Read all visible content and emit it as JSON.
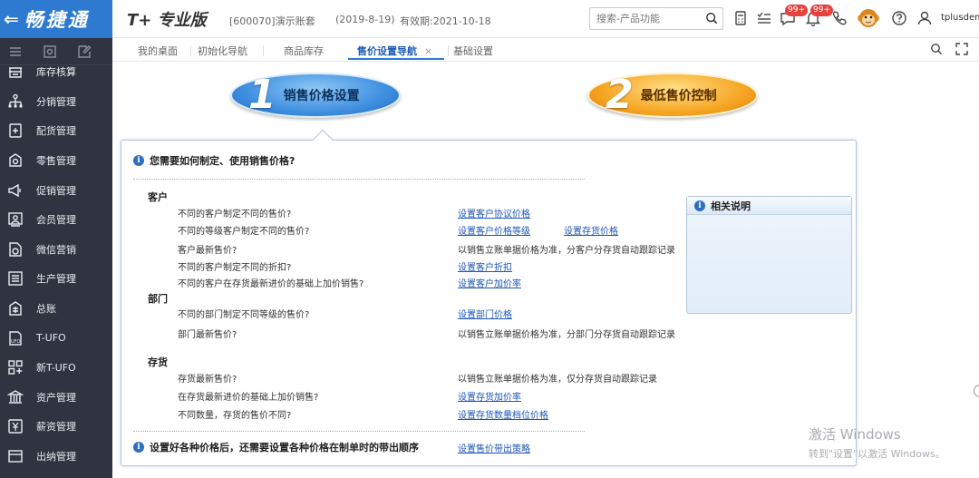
{
  "brand": {
    "back_glyph": "⇐",
    "name": "畅捷通"
  },
  "header": {
    "product": "T+ 专业版",
    "account": "[600070]演示账套",
    "period": "(2019-8-19)",
    "validity": "有效期:2021-10-18",
    "search_placeholder": "搜索-产品功能",
    "badge_messages": "99+",
    "badge_notices": "99+",
    "user": "tplusdem"
  },
  "tabs": [
    {
      "label": "我的桌面"
    },
    {
      "label": "初始化导航"
    },
    {
      "label": "商品库存"
    },
    {
      "label": "售价设置导航",
      "active": true,
      "close": "×"
    },
    {
      "label": "基础设置"
    }
  ],
  "sidebar": {
    "items": [
      {
        "label": "库存核算",
        "icon": "inventory-icon"
      },
      {
        "label": "分销管理",
        "icon": "distribution-icon"
      },
      {
        "label": "配货管理",
        "icon": "allocation-icon"
      },
      {
        "label": "零售管理",
        "icon": "retail-icon"
      },
      {
        "label": "促销管理",
        "icon": "promotion-icon"
      },
      {
        "label": "会员管理",
        "icon": "member-icon"
      },
      {
        "label": "微信营销",
        "icon": "wechat-icon"
      },
      {
        "label": "生产管理",
        "icon": "production-icon"
      },
      {
        "label": "总账",
        "icon": "ledger-icon"
      },
      {
        "label": "T-UFO",
        "icon": "ufo-icon"
      },
      {
        "label": "新T-UFO",
        "icon": "new-ufo-icon"
      },
      {
        "label": "资产管理",
        "icon": "asset-icon"
      },
      {
        "label": "薪资管理",
        "icon": "salary-icon"
      },
      {
        "label": "出纳管理",
        "icon": "cashier-icon"
      }
    ]
  },
  "steps": [
    {
      "num": "1",
      "label": "销售价格设置"
    },
    {
      "num": "2",
      "label": "最低售价控制"
    }
  ],
  "guide": {
    "question": "您需要如何制定、使用销售价格?",
    "sections": [
      {
        "title": "客户",
        "rows": [
          {
            "q": "不同的客户制定不同的售价?",
            "a": "设置客户协议价格",
            "link": true
          },
          {
            "q": "不同的等级客户制定不同的售价?",
            "a": "设置客户价格等级",
            "link": true,
            "a2": "设置存货价格"
          },
          {
            "q": "客户最新售价?",
            "a": "以销售立账单据价格为准，分客户分存货自动跟踪记录",
            "link": false
          },
          {
            "q": "不同的客户制定不同的折扣?",
            "a": "设置客户折扣",
            "link": true
          },
          {
            "q": "不同的客户在存货最新进价的基础上加价销售?",
            "a": "设置客户加价率",
            "link": true
          }
        ]
      },
      {
        "title": "部门",
        "rows": [
          {
            "q": "不同的部门制定不同等级的售价?",
            "a": "设置部门价格",
            "link": true
          },
          {
            "q": "部门最新售价?",
            "a": "以销售立账单据价格为准，分部门分存货自动跟踪记录",
            "link": false
          }
        ]
      },
      {
        "title": "存货",
        "rows": [
          {
            "q": "存货最新售价?",
            "a": "以销售立账单据价格为准，仅分存货自动跟踪记录",
            "link": false
          },
          {
            "q": "在存货最新进价的基础上加价销售?",
            "a": "设置存货加价率",
            "link": true
          },
          {
            "q": "不同数量，存货的售价不同?",
            "a": "设置存货数量档位价格",
            "link": true
          }
        ]
      }
    ],
    "bottom_text": "设置好各种价格后，还需要设置各种价格在制单时的带出顺序",
    "bottom_link": "设置售价带出策略",
    "side_note_title": "相关说明"
  },
  "watermark": {
    "line1": "激活 Windows",
    "line2": "转到\"设置\"以激活 Windows。"
  },
  "colors": {
    "brand": "#2e7ad1",
    "sidebar": "#2f3440",
    "link": "#1f57b8",
    "badge": "#e8403c"
  }
}
